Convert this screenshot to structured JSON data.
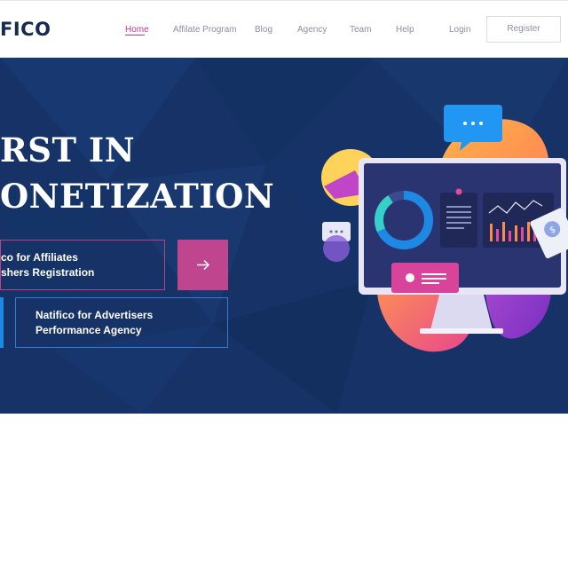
{
  "header": {
    "logo_text": "FICO",
    "nav": [
      {
        "label": "Home",
        "active": true
      },
      {
        "label": "Affilate Program"
      },
      {
        "label": "Blog"
      },
      {
        "label": "Agency"
      },
      {
        "label": "Team"
      },
      {
        "label": "Help"
      }
    ],
    "login_label": "Login",
    "register_label": "Register"
  },
  "hero": {
    "headline_line1": "RST IN",
    "headline_line2": "ONETIZATION",
    "card_affiliates": {
      "line1": "co for Affiliates",
      "line2": "shers Registration"
    },
    "card_advertisers": {
      "line1": "Natifico for Advertisers",
      "line2": "Performance Agency"
    }
  },
  "colors": {
    "brand_dark": "#172a4f",
    "hero_bg": "#163267",
    "accent_pink": "#c0458f",
    "accent_blue": "#1e88e5",
    "nav_active": "#c03a8c"
  },
  "icons": {
    "arrow": "arrow-right-icon"
  }
}
